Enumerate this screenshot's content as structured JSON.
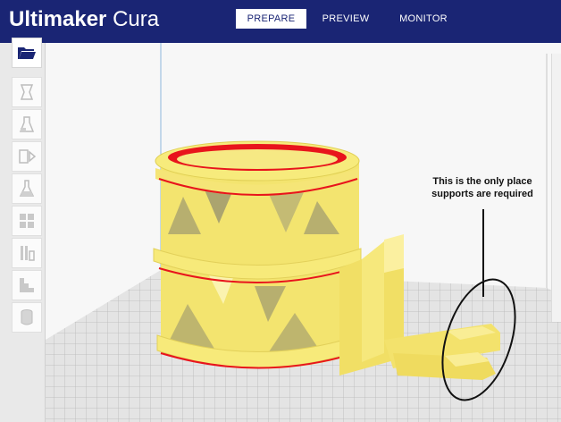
{
  "app": {
    "brand_bold": "Ultimaker",
    "brand_light": "Cura"
  },
  "tabs": [
    {
      "label": "PREPARE",
      "active": true
    },
    {
      "label": "PREVIEW",
      "active": false
    },
    {
      "label": "MONITOR",
      "active": false
    }
  ],
  "sidebar": {
    "tools": [
      {
        "icon": "open-folder-icon"
      },
      {
        "icon": "move-icon"
      },
      {
        "icon": "scale-icon"
      },
      {
        "icon": "rotate-icon"
      },
      {
        "icon": "mirror-icon"
      },
      {
        "icon": "per-model-settings-icon"
      },
      {
        "icon": "support-blocker-icon"
      },
      {
        "icon": "stairs-icon"
      },
      {
        "icon": "cylinder-icon"
      }
    ]
  },
  "annotation": {
    "line1": "This is the only place",
    "line2": "supports are required"
  },
  "colors": {
    "topbar": "#1a2574",
    "model": "#f8ea7c",
    "overhang": "#e8141c",
    "buildplate_grid": "#b8b8b8"
  }
}
